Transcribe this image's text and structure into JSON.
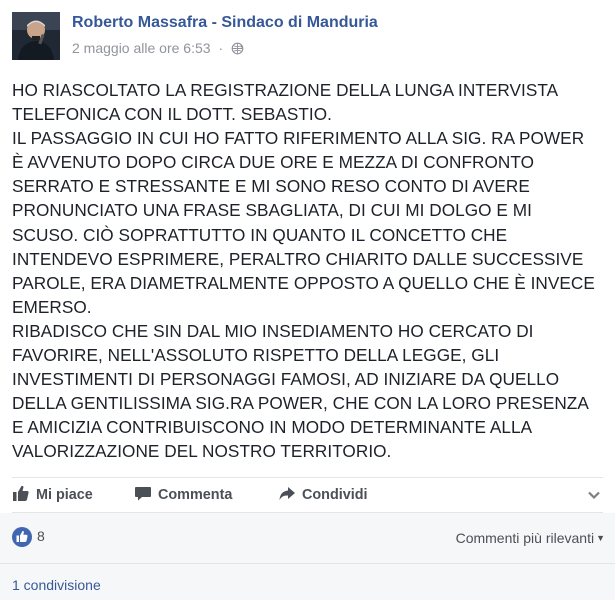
{
  "post": {
    "author": "Roberto Massafra - Sindaco di Manduria",
    "timestamp": "2 maggio alle ore 6:53",
    "meta_separator": "·",
    "privacy_icon": "globe-icon",
    "body_lines": [
      "HO RIASCOLTATO LA REGISTRAZIONE DELLA LUNGA INTERVISTA",
      "TELEFONICA CON IL DOTT. SEBASTIO.",
      "IL PASSAGGIO IN CUI HO FATTO RIFERIMENTO ALLA SIG. RA POWER",
      "È AVVENUTO DOPO CIRCA DUE ORE E MEZZA DI CONFRONTO",
      "SERRATO E STRESSANTE E MI SONO RESO CONTO DI AVERE",
      "PRONUNCIATO UNA FRASE SBAGLIATA, DI CUI MI DOLGO E MI",
      "SCUSO. CIÒ SOPRATTUTTO IN QUANTO IL CONCETTO CHE",
      "INTENDEVO ESPRIMERE, PERALTRO CHIARITO DALLE SUCCESSIVE",
      "PAROLE, ERA DIAMETRALMENTE OPPOSTO A QUELLO CHE È INVECE",
      "EMERSO.",
      "RIBADISCO CHE SIN DAL MIO INSEDIAMENTO HO CERCATO DI",
      "FAVORIRE, NELL'ASSOLUTO RISPETTO DELLA LEGGE, GLI",
      "INVESTIMENTI DI PERSONAGGI FAMOSI, AD INIZIARE DA QUELLO",
      "DELLA GENTILISSIMA SIG.RA POWER, CHE CON LA LORO PRESENZA",
      "E AMICIZIA CONTRIBUISCONO IN MODO DETERMINANTE ALLA",
      "VALORIZZAZIONE DEL NOSTRO TERRITORIO."
    ]
  },
  "actions": {
    "like_label": "Mi piace",
    "comment_label": "Commenta",
    "share_label": "Condividi"
  },
  "reactions": {
    "like_count": "8",
    "sort_label": "Commenti più rilevanti",
    "sort_caret": "▼"
  },
  "shares": {
    "label": "1 condivisione"
  },
  "colors": {
    "author_link": "#365899",
    "meta_gray": "#90949c",
    "action_gray": "#4b4f56",
    "like_blue": "#4267b2",
    "footer_bg": "#f6f7f9"
  }
}
